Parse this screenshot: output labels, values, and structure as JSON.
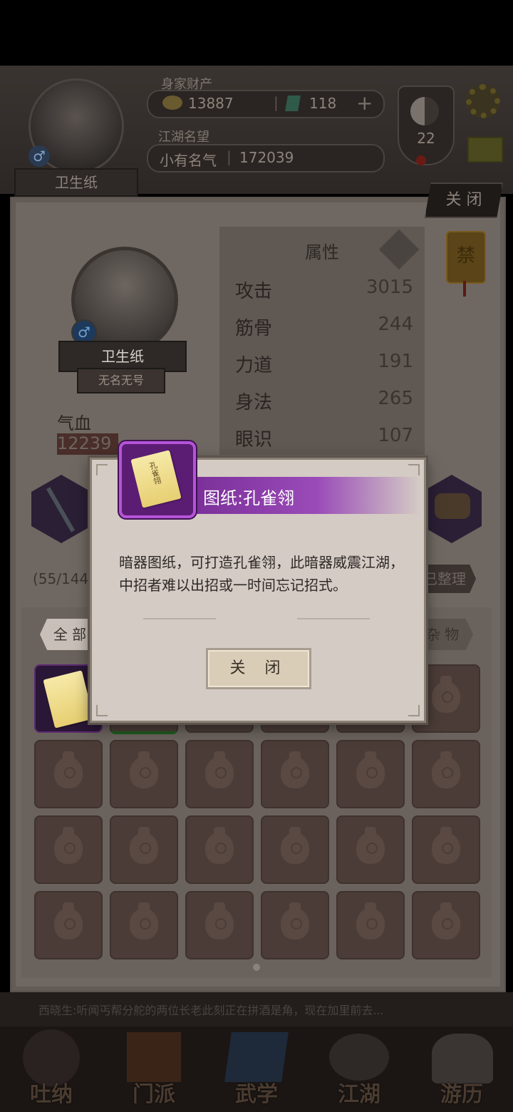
{
  "header": {
    "player_name": "卫生纸",
    "wealth_label": "身家财产",
    "silver": "13887",
    "jade": "118",
    "fame_label": "江湖名望",
    "fame_title": "小有名气",
    "fame_value": "172039",
    "level": "22"
  },
  "panel": {
    "close_label": "关 闭",
    "character_name": "卫生纸",
    "character_title": "无名无号",
    "hp_label": "气血",
    "hp_value": "12239",
    "stats_title": "属性",
    "stats": [
      {
        "label": "攻击",
        "value": "3015"
      },
      {
        "label": "筋骨",
        "value": "244"
      },
      {
        "label": "力道",
        "value": "191"
      },
      {
        "label": "身法",
        "value": "265"
      },
      {
        "label": "眼识",
        "value": "107"
      }
    ],
    "ban_badge": "禁",
    "inventory_count": "(55/144",
    "sort_label": "已整理",
    "tab_all": "全 部",
    "tab_misc": "杂 物",
    "news_line1": "西...",
    "news_line2": "西晓生:听闻丐帮分舵的两位长老此刻正在拼酒是角，现在加里前去..."
  },
  "modal": {
    "title": "图纸:孔雀翎",
    "icon_text": "孔雀翎",
    "description": "暗器图纸，可打造孔雀翎，此暗器威震江湖，中招者难以出招或一时间忘记招式。",
    "close_label": "关 闭"
  },
  "nav": [
    {
      "label": "吐纳"
    },
    {
      "label": "门派"
    },
    {
      "label": "武学"
    },
    {
      "label": "江湖"
    },
    {
      "label": "游历"
    }
  ]
}
